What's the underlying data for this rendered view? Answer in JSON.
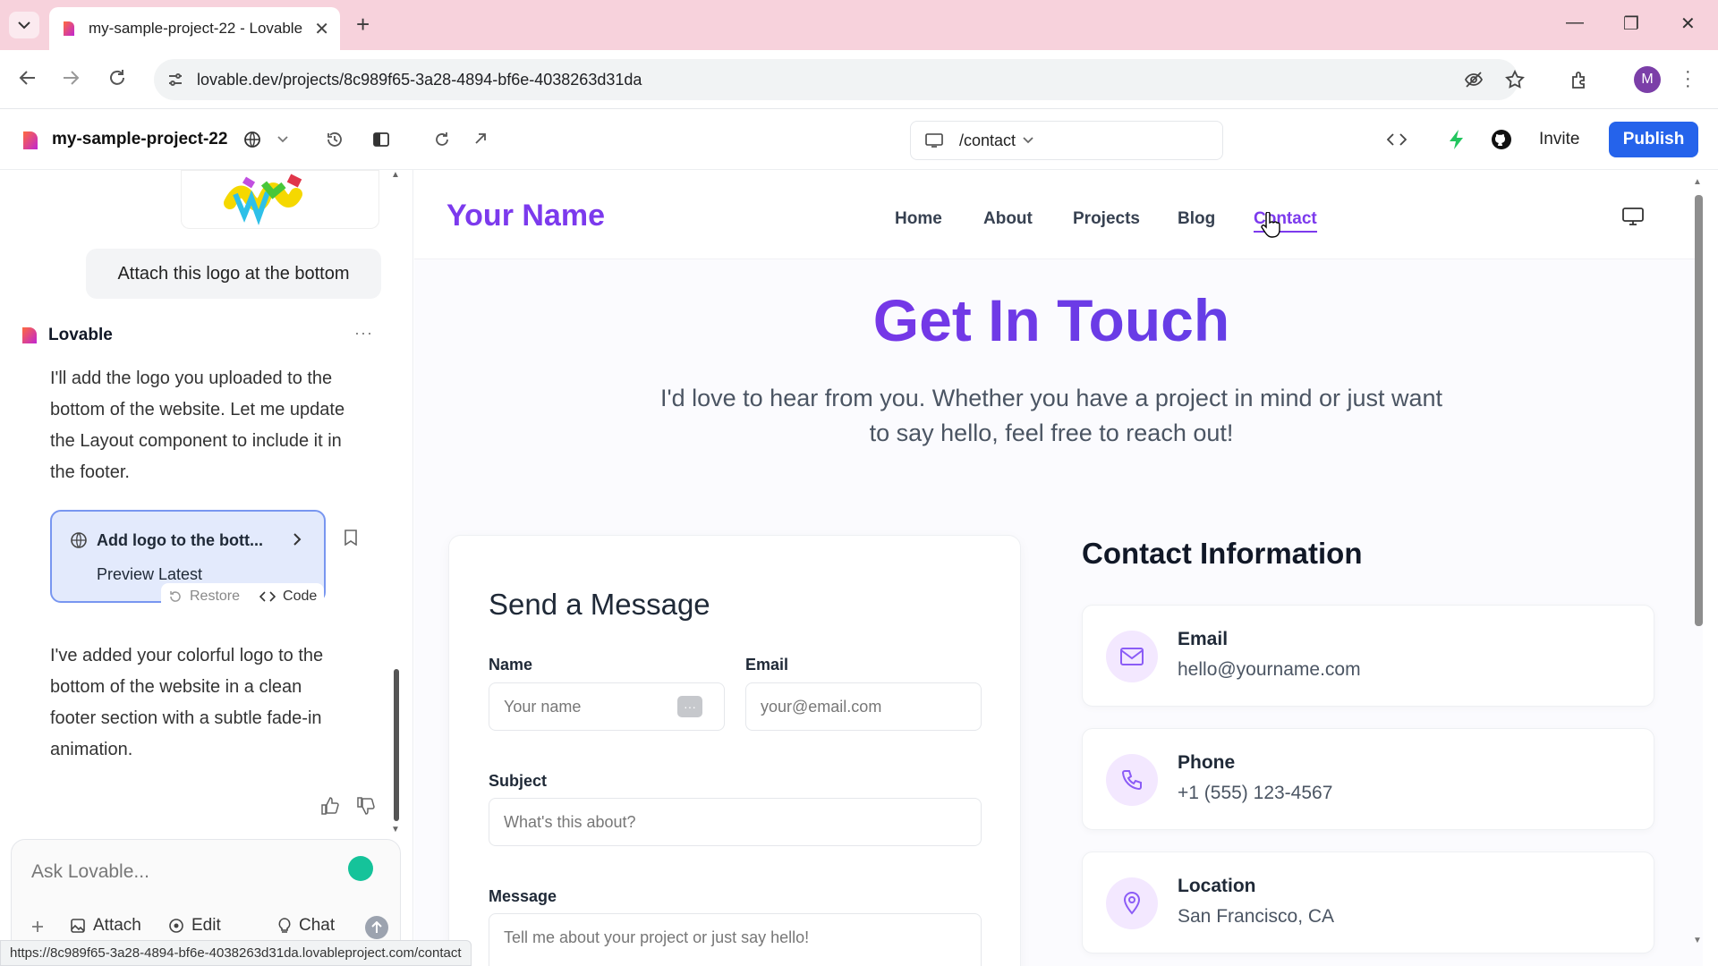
{
  "browser": {
    "tab_title": "my-sample-project-22 - Lovable",
    "url": "lovable.dev/projects/8c989f65-3a28-4894-bf6e-4038263d31da",
    "profile_initial": "M",
    "status_url": "https://8c989f65-3a28-4894-bf6e-4038263d31da.lovableproject.com/contact"
  },
  "app": {
    "project_name": "my-sample-project-22",
    "route": "/contact",
    "invite_label": "Invite",
    "publish_label": "Publish",
    "accent": "#2563eb"
  },
  "chat": {
    "user_message": "Attach this logo at the bottom",
    "bot_name": "Lovable",
    "bot_more": "···",
    "bot_message_1": [
      "I'll add the logo you uploaded to the",
      "bottom of the website. Let me update",
      "the Layout component to include it in",
      "the footer."
    ],
    "version_card": {
      "title": "Add logo to the bott...",
      "subtitle": "Preview Latest",
      "restore_label": "Restore",
      "code_label": "Code"
    },
    "bot_message_2": [
      "I've added your colorful logo to the",
      "bottom of the website in a clean",
      "footer section with a subtle fade-in",
      "animation."
    ],
    "composer_placeholder": "Ask Lovable...",
    "composer_actions": [
      "Attach",
      "Edit",
      "Chat"
    ]
  },
  "preview": {
    "brand": "Your Name",
    "nav": [
      "Home",
      "About",
      "Projects",
      "Blog",
      "Contact"
    ],
    "active_nav": "Contact",
    "hero_title": "Get In Touch",
    "lead_lines": [
      "I'd love to hear from you. Whether you have a project in mind or just want",
      "to say hello, feel free to reach out!"
    ],
    "form": {
      "title": "Send a Message",
      "name_label": "Name",
      "name_placeholder": "Your name",
      "email_label": "Email",
      "email_placeholder": "your@email.com",
      "subject_label": "Subject",
      "subject_placeholder": "What's this about?",
      "message_label": "Message",
      "message_placeholder": "Tell me about your project or just say hello!"
    },
    "contact": {
      "title": "Contact Information",
      "items": [
        {
          "label": "Email",
          "value": "hello@yourname.com",
          "icon": "mail-icon"
        },
        {
          "label": "Phone",
          "value": "+1 (555) 123-4567",
          "icon": "phone-icon"
        },
        {
          "label": "Location",
          "value": "San Francisco, CA",
          "icon": "map-pin-icon"
        }
      ]
    },
    "brand_color": "#7c3aed"
  }
}
